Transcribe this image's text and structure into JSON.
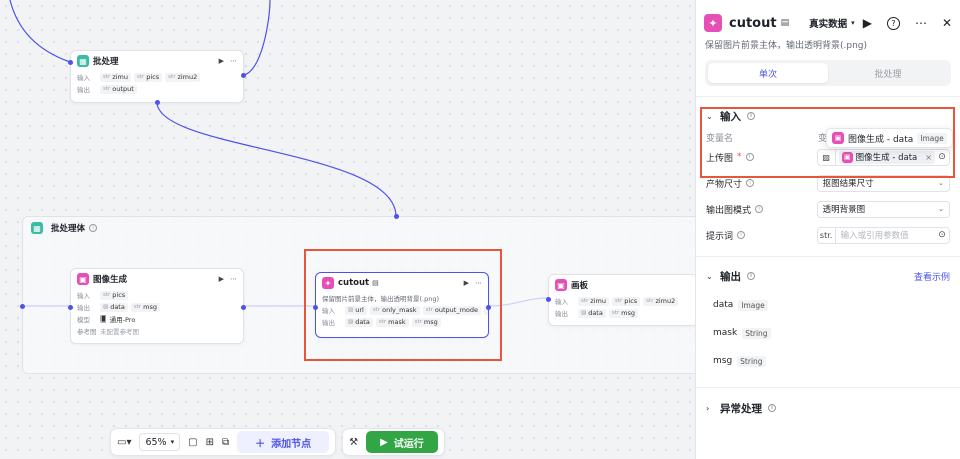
{
  "canvas": {
    "top_node": {
      "title": "批处理",
      "input_label": "输入",
      "inputs": [
        "zimu",
        "pics",
        "zimu2"
      ],
      "output_label": "输出",
      "outputs": [
        "output"
      ]
    },
    "batch_body": {
      "title": "批处理体"
    },
    "image_gen_node": {
      "title": "图像生成",
      "input_label": "输入",
      "inputs": [
        "pics"
      ],
      "output_label": "输出",
      "outputs": [
        "data",
        "msg"
      ],
      "model_label": "模型",
      "model_value": "通用-Pro",
      "ref_label": "参考图",
      "ref_value": "未配置参考图"
    },
    "cutout_node": {
      "title": "cutout",
      "desc": "保留图片前景主体，输出透明背景(.png)",
      "input_label": "输入",
      "inputs": [
        "url",
        "only_mask",
        "output_mode"
      ],
      "output_label": "输出",
      "outputs": [
        "data",
        "mask",
        "msg"
      ]
    },
    "canvas_node": {
      "title": "画板",
      "input_label": "输入",
      "inputs": [
        "zimu",
        "pics",
        "zimu2"
      ],
      "output_label": "输出",
      "outputs": [
        "data",
        "msg"
      ]
    }
  },
  "toolbar": {
    "zoom": "65%",
    "add_node": "添加节点",
    "test_run": "试运行"
  },
  "panel": {
    "title": "cutout",
    "data_mode": "真实数据",
    "desc": "保留图片前景主体，输出透明背景(.png)",
    "tabs": [
      {
        "label": "单次",
        "active": true
      },
      {
        "label": "批处理",
        "active": false
      }
    ],
    "input_section": {
      "title": "输入",
      "col_var": "变量名",
      "col_var2": "变",
      "tooltip_text": "图像生成 - data",
      "tooltip_tag": "Image",
      "upload_label": "上传图",
      "upload_ref": "图像生成 - data"
    },
    "params": [
      {
        "label": "产物尺寸",
        "value": "抠图结果尺寸"
      },
      {
        "label": "输出图模式",
        "value": "透明背景图"
      }
    ],
    "prompt": {
      "label": "提示词",
      "prefix": "str.",
      "placeholder": "输入或引用参数值"
    },
    "output_section": {
      "title": "输出",
      "link": "查看示例",
      "items": [
        {
          "name": "data",
          "type": "Image"
        },
        {
          "name": "mask",
          "type": "String"
        },
        {
          "name": "msg",
          "type": "String"
        }
      ]
    },
    "error_section": {
      "title": "异常处理"
    }
  },
  "colors": {
    "accent": "#4d53e8",
    "highlight": "#e5563a",
    "run_green": "#32a645",
    "teal_icon": "#3db9a8",
    "pink_icon": "#e64fb5"
  }
}
